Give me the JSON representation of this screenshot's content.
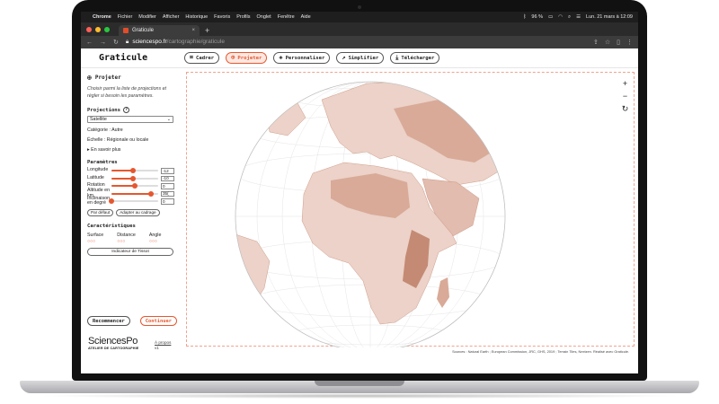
{
  "menubar": {
    "items": [
      "Chrome",
      "Fichier",
      "Modifier",
      "Afficher",
      "Historique",
      "Favoris",
      "Profils",
      "Onglet",
      "Fenêtre",
      "Aide"
    ],
    "battery": "96 %",
    "datetime": "Lun. 21 mars à 12:09"
  },
  "browser": {
    "tab_title": "Graticule",
    "url_host": "sciencespo.fr",
    "url_path": "/cartographie/graticule"
  },
  "app": {
    "logo": "Graticule",
    "tools": [
      {
        "label": "Cadrer",
        "icon": "crop-icon"
      },
      {
        "label": "Projeter",
        "icon": "globe-icon"
      },
      {
        "label": "Personnaliser",
        "icon": "layers-icon"
      },
      {
        "label": "Simplifier",
        "icon": "trend-icon"
      },
      {
        "label": "Télécharger",
        "icon": "download-icon"
      }
    ],
    "active_tool": "Projeter"
  },
  "sidebar": {
    "title": "Projeter",
    "description": "Choisir parmi la liste de projections et régler si besoin les paramètres.",
    "projections_label": "Projections",
    "projection_value": "Satellite",
    "categorie": "Catégorie : Autre",
    "echelle": "Échelle : Régionale ou locale",
    "more": "En savoir plus",
    "params_label": "Paramètres",
    "params": [
      {
        "label": "Longitude",
        "value": "-12",
        "level": 0.47
      },
      {
        "label": "Latitude",
        "value": "-10",
        "level": 0.46
      },
      {
        "label": "Rotation",
        "value": "0",
        "level": 0.5
      },
      {
        "label": "Altitude en km",
        "value": "35(",
        "level": 0.85
      },
      {
        "label": "Inclinaison en degré",
        "value": "0",
        "level": 0.0
      }
    ],
    "btn_default": "Par défaut",
    "btn_fit": "Adapter au cadrage",
    "carac_label": "Caractéristiques",
    "carac": [
      {
        "label": "Surface",
        "dots": "○○○"
      },
      {
        "label": "Distance",
        "dots": "○○○"
      },
      {
        "label": "Angle",
        "dots": "○○○"
      }
    ],
    "tissot": "Indicateur de Tissot",
    "restart": "Recommencer",
    "continue": "Continuer",
    "brand_name": "SciencesPo",
    "brand_sub": "ATELIER DE CARTOGRAPHIE",
    "about": "À propos",
    "version": "v1"
  },
  "map": {
    "zoom_in": "+",
    "zoom_out": "−",
    "reset": "↻",
    "sources": "Sources : Natural Earth ; European Commission, JRC, GHS, 2019 ; Terrain Tiles, Nextzen. Réalisé avec Graticule."
  },
  "colors": {
    "accent": "#e5572f",
    "land_light": "#ecd2c8",
    "land_mid": "#d9aa98",
    "land_dark": "#c48a74"
  }
}
